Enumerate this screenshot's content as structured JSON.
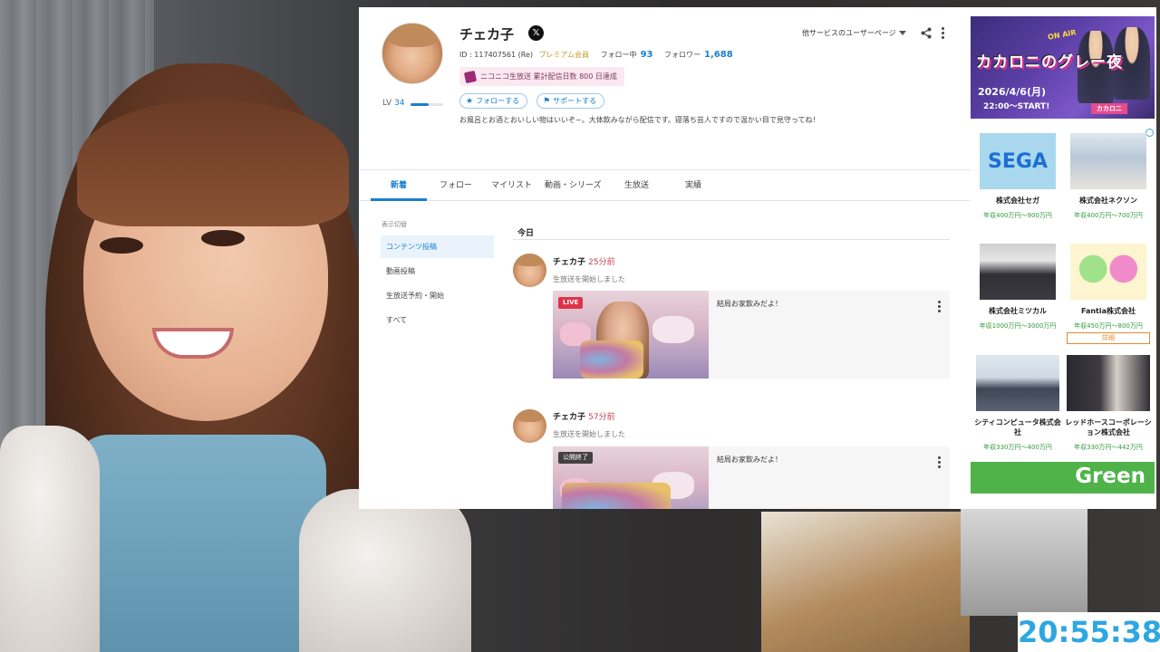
{
  "profile": {
    "name": "チェカ子",
    "id_text": "ID : 117407561 (Re)",
    "premium": "プレミアム会員",
    "following_label": "フォロー中",
    "following_count": "93",
    "followers_label": "フォロワー",
    "followers_count": "1,688",
    "badge": "ニコニコ生放送 累計配信日数 800 日達成",
    "level_label": "LV",
    "level_value": "34",
    "level_progress": 0.55,
    "follow_button": "フォローする",
    "support_button": "サポートする",
    "bio": "お風呂とお酒とおいしい物はいいぞ~。大体飲みながら配信です。寝落ち芸人ですので温かい目で見守ってね！",
    "other_services": "他サービスのユーザーページ"
  },
  "tabs": [
    "新着",
    "フォロー",
    "マイリスト",
    "動画・シリーズ",
    "生放送",
    "実績"
  ],
  "filter": {
    "heading": "表示切替",
    "items": [
      "コンテンツ投稿",
      "動画投稿",
      "生放送予約・開始",
      "すべて"
    ]
  },
  "feed": {
    "date_heading": "今日",
    "posts": [
      {
        "author": "チェカ子",
        "time": "25分前",
        "text": "生放送を開始しました",
        "badge": "LIVE",
        "title": "結局お家飲みだよ！"
      },
      {
        "author": "チェカ子",
        "time": "57分前",
        "text": "生放送を開始しました",
        "badge": "公開終了",
        "title": "結局お家飲みだよ！"
      }
    ]
  },
  "ads": {
    "banner": {
      "onair": "ON AIR",
      "title": "カカロニのグレー夜",
      "date": "2026/4/6(月)",
      "time": "22:00～START!",
      "brand": "カカロニ"
    },
    "jobs": [
      {
        "company": "株式会社セガ",
        "salary": "年収400万円～900万円",
        "logo": "SEGA"
      },
      {
        "company": "株式会社ネクソン",
        "salary": "年収400万円～700万円"
      },
      {
        "company": "株式会社ミツカル",
        "salary": "年収1000万円～3000万円"
      },
      {
        "company": "Fantia株式会社",
        "salary": "年収450万円～800万円",
        "more": "詳細"
      },
      {
        "company": "シティコンピュータ株式会社",
        "salary": "年収330万円～400万円"
      },
      {
        "company": "レッドホースコーポレーション株式会社",
        "salary": "年収330万円～442万円"
      }
    ],
    "footer_brand": "Green"
  },
  "clock": "20:55:38",
  "colors": {
    "accent": "#1a7fd0",
    "live": "#e0314b",
    "salary": "#2f9a3a",
    "clock": "#2ea7e0"
  }
}
